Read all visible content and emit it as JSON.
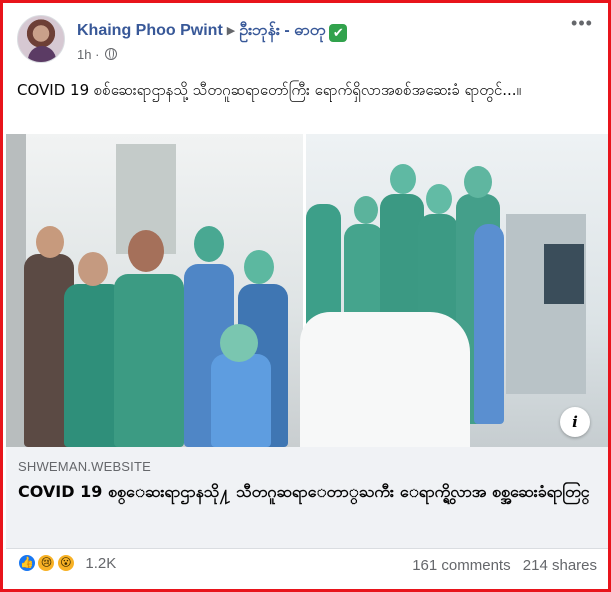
{
  "post": {
    "author": "Khaing Phoo Pwint",
    "group": "ဦးဘုန်း - ဓာတု",
    "time": "1h",
    "dot": "·",
    "text": "COVID 19 စစ်ဆေးရာဌာနသို့ သီတဂူဆရာတော်ကြီး ရောက်ရှိလာအစစ်အဆေးခံ ရာတွင်...။"
  },
  "link_preview": {
    "domain": "SHWEMAN.WEBSITE",
    "title": "COVID 19 စစ္ေဆးရာဌာနသို႔ သီတဂူဆရာေတာ္ႀကီး ေရာက္ရွိလာအ စစ္အဆေးခံရာတြင္"
  },
  "reactions": {
    "icons": [
      "like-icon",
      "sad-icon",
      "wow-icon"
    ],
    "count": "1.2K"
  },
  "stats": {
    "comments": "161 comments",
    "shares": "214 shares"
  },
  "colors": {
    "border": "#e8141b",
    "link_blue": "#385898",
    "verified_green": "#31a24c",
    "muted": "#65676b",
    "preview_bg": "#f0f2f5"
  }
}
